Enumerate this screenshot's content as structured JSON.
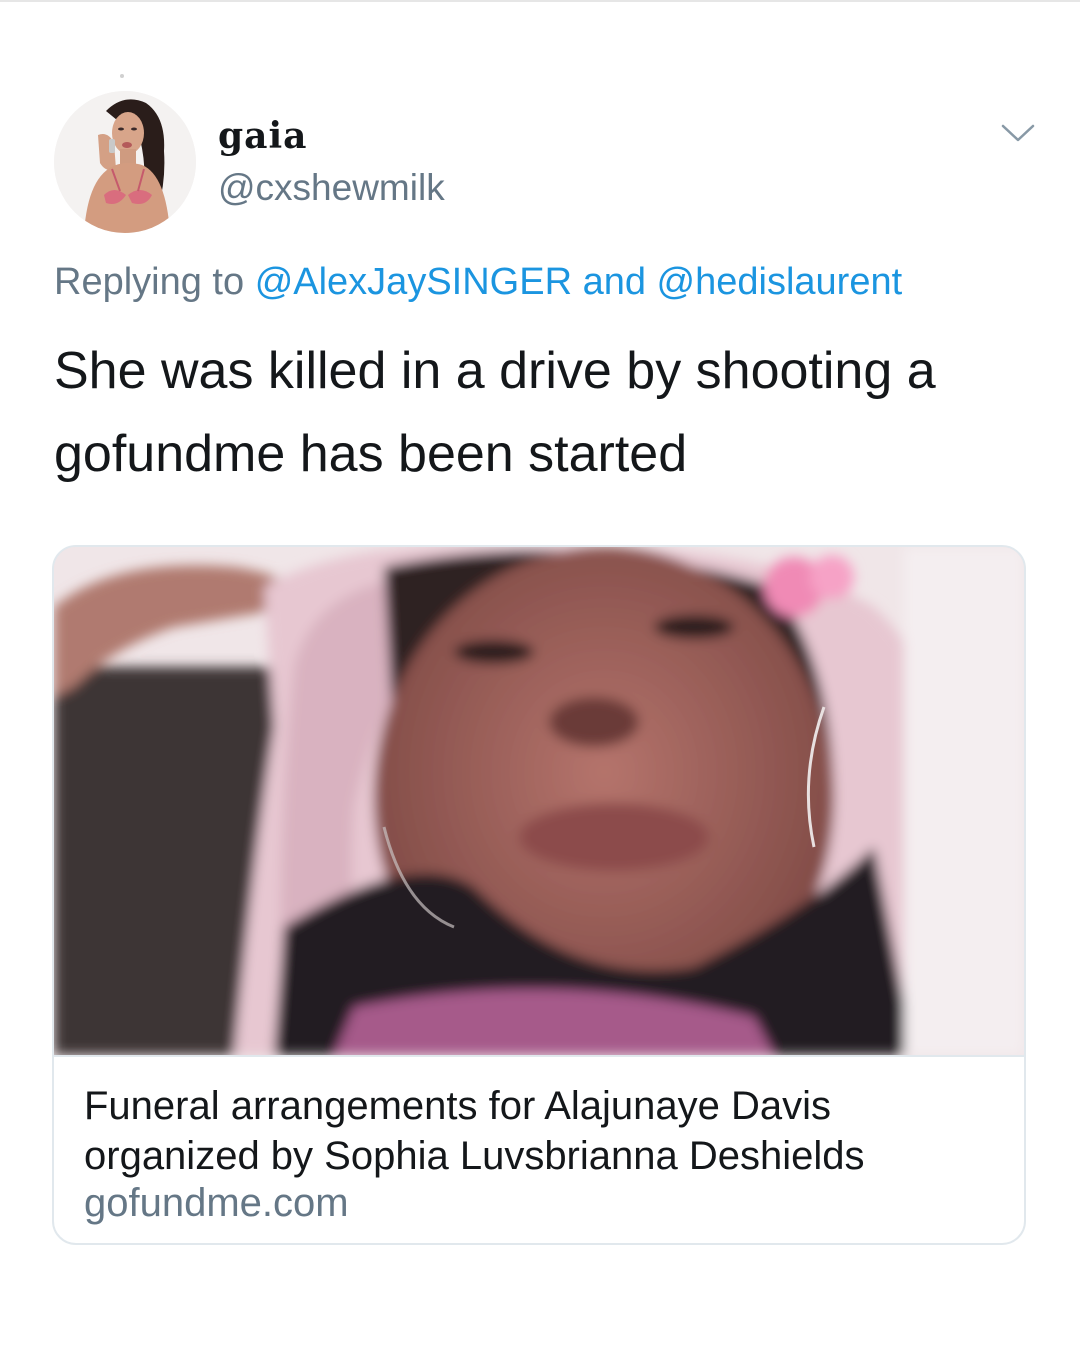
{
  "tweet": {
    "display_name": "gaia",
    "handle": "@cxshewmilk",
    "replying_prefix": "Replying to",
    "reply_mention_1": "@AlexJaySINGER",
    "reply_conjunction": "and",
    "reply_mention_2": "@hedislaurent",
    "text_line_1": "She was killed in a drive by shooting a",
    "text_line_2": "gofundme has been started"
  },
  "card": {
    "title_line_1": "Funeral arrangements for Alajunaye Davis",
    "title_line_2": "organized by Sophia Luvsbrianna Deshields",
    "domain": "gofundme.com"
  },
  "colors": {
    "text_primary": "#14171a",
    "text_secondary": "#657786",
    "link": "#1b95e0",
    "border": "#e1e8ed"
  },
  "icons": {
    "more_options": "chevron-down-icon"
  }
}
